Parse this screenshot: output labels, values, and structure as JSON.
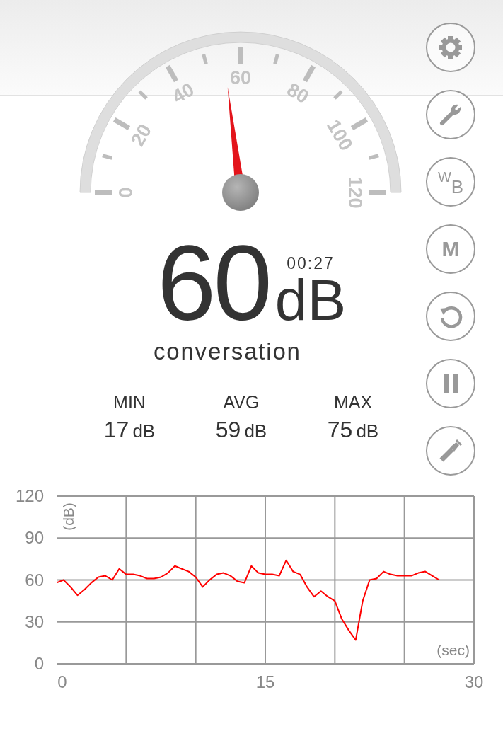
{
  "gauge": {
    "scale_labels": [
      "0",
      "20",
      "40",
      "60",
      "80",
      "100",
      "120"
    ]
  },
  "reading": {
    "value": "60",
    "unit": "dB",
    "timer": "00:27",
    "description": "conversation"
  },
  "stats": [
    {
      "label": "MIN",
      "value": "17",
      "unit": "dB"
    },
    {
      "label": "AVG",
      "value": "59",
      "unit": "dB"
    },
    {
      "label": "MAX",
      "value": "75",
      "unit": "dB"
    }
  ],
  "buttons": [
    {
      "kind": "settings"
    },
    {
      "kind": "wrench"
    },
    {
      "kind": "text",
      "label": "$^{W}$$_{B}$"
    },
    {
      "kind": "text",
      "label": "M"
    },
    {
      "kind": "reset"
    },
    {
      "kind": "pause"
    },
    {
      "kind": "flashlight"
    }
  ],
  "chart": {
    "chart_data": {
      "type": "line",
      "xlabel": "(sec)",
      "ylabel": "(dB)",
      "xlim": [
        0,
        30
      ],
      "ylim": [
        0,
        120
      ],
      "xticks": [
        0,
        15,
        30
      ],
      "yticks": [
        0,
        30,
        60,
        90,
        120
      ],
      "grid": true,
      "x": [
        0,
        0.5,
        1,
        1.5,
        2,
        2.5,
        3,
        3.5,
        4,
        4.5,
        5,
        5.5,
        6,
        6.5,
        7,
        7.5,
        8,
        8.5,
        9,
        9.5,
        10,
        10.5,
        11,
        11.5,
        12,
        12.5,
        13,
        13.5,
        14,
        14.5,
        15,
        15.5,
        16,
        16.5,
        17,
        17.5,
        18,
        18.5,
        19,
        19.5,
        20,
        20.5,
        21,
        21.5,
        22,
        22.5,
        23,
        23.5,
        24,
        24.5,
        25,
        25.5,
        26,
        26.5,
        27,
        27.5
      ],
      "series": [
        {
          "color": "#ff0000",
          "values": [
            58,
            60,
            55,
            49,
            53,
            58,
            62,
            63,
            60,
            68,
            64,
            64,
            63,
            61,
            61,
            62,
            65,
            70,
            68,
            66,
            62,
            55,
            60,
            64,
            65,
            63,
            59,
            58,
            70,
            65,
            64,
            64,
            63,
            74,
            66,
            64,
            55,
            48,
            52,
            48,
            45,
            32,
            24,
            17,
            45,
            60,
            61,
            66,
            64,
            63,
            63,
            63,
            65,
            66,
            63,
            60
          ]
        }
      ]
    }
  }
}
